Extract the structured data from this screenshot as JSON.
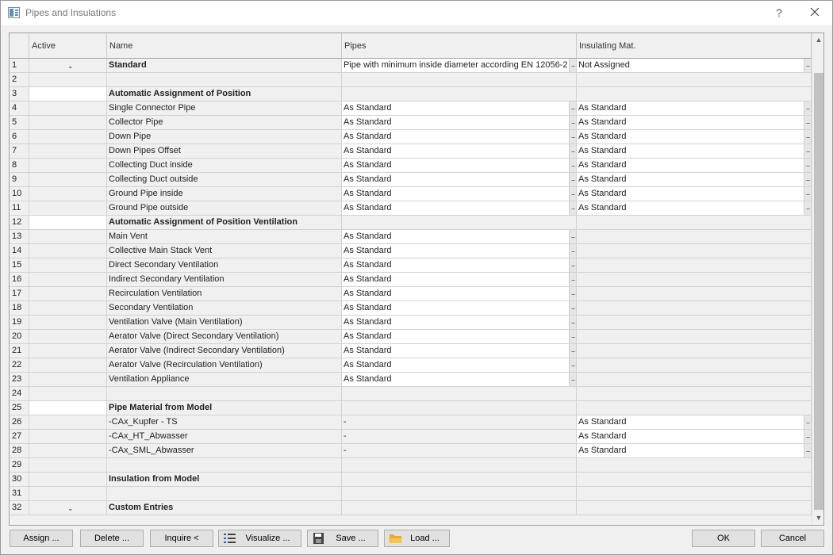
{
  "window": {
    "title": "Pipes and Insulations",
    "help_label": "?"
  },
  "columns": {
    "active": "Active",
    "name": "Name",
    "pipes": "Pipes",
    "insulating": "Insulating Mat."
  },
  "rows": [
    {
      "num": "1",
      "name": "Standard",
      "bold": true,
      "chevron": true,
      "pipes": "Pipe with minimum inside diameter according EN 12056-2",
      "pipes_btn": true,
      "insul": "Not Assigned",
      "insul_btn": true
    },
    {
      "num": "2",
      "name": "",
      "pipes": "",
      "insul": ""
    },
    {
      "num": "3",
      "name": "Automatic Assignment of Position",
      "bold": true,
      "active_white": true,
      "pipes": "",
      "insul": ""
    },
    {
      "num": "4",
      "name": "Single Connector Pipe",
      "pipes": "As Standard",
      "pipes_btn": true,
      "insul": "As Standard",
      "insul_btn": true
    },
    {
      "num": "5",
      "name": "Collector Pipe",
      "pipes": "As Standard",
      "pipes_btn": true,
      "insul": "As Standard",
      "insul_btn": true
    },
    {
      "num": "6",
      "name": "Down Pipe",
      "pipes": "As Standard",
      "pipes_btn": true,
      "insul": "As Standard",
      "insul_btn": true
    },
    {
      "num": "7",
      "name": "Down Pipes Offset",
      "pipes": "As Standard",
      "pipes_btn": true,
      "insul": "As Standard",
      "insul_btn": true
    },
    {
      "num": "8",
      "name": "Collecting Duct inside",
      "pipes": "As Standard",
      "pipes_btn": true,
      "insul": "As Standard",
      "insul_btn": true
    },
    {
      "num": "9",
      "name": "Collecting Duct outside",
      "pipes": "As Standard",
      "pipes_btn": true,
      "insul": "As Standard",
      "insul_btn": true
    },
    {
      "num": "10",
      "name": "Ground Pipe inside",
      "pipes": "As Standard",
      "pipes_btn": true,
      "insul": "As Standard",
      "insul_btn": true
    },
    {
      "num": "11",
      "name": "Ground Pipe outside",
      "pipes": "As Standard",
      "pipes_btn": true,
      "insul": "As Standard",
      "insul_btn": true
    },
    {
      "num": "12",
      "name": "Automatic Assignment of Position Ventilation",
      "bold": true,
      "active_white": true,
      "pipes": "",
      "insul": ""
    },
    {
      "num": "13",
      "name": "Main Vent",
      "pipes": "As Standard",
      "pipes_btn": true,
      "insul": ""
    },
    {
      "num": "14",
      "name": "Collective Main Stack Vent",
      "pipes": "As Standard",
      "pipes_btn": true,
      "insul": ""
    },
    {
      "num": "15",
      "name": "Direct Secondary Ventilation",
      "pipes": "As Standard",
      "pipes_btn": true,
      "insul": ""
    },
    {
      "num": "16",
      "name": "Indirect Secondary Ventilation",
      "pipes": "As Standard",
      "pipes_btn": true,
      "insul": ""
    },
    {
      "num": "17",
      "name": "Recirculation Ventilation",
      "pipes": "As Standard",
      "pipes_btn": true,
      "insul": ""
    },
    {
      "num": "18",
      "name": "Secondary Ventilation",
      "pipes": "As Standard",
      "pipes_btn": true,
      "insul": ""
    },
    {
      "num": "19",
      "name": "Ventilation Valve (Main Ventilation)",
      "pipes": "As Standard",
      "pipes_btn": true,
      "insul": ""
    },
    {
      "num": "20",
      "name": "Aerator Valve (Direct Secondary Ventilation)",
      "pipes": "As Standard",
      "pipes_btn": true,
      "insul": ""
    },
    {
      "num": "21",
      "name": "Aerator Valve (Indirect Secondary Ventilation)",
      "pipes": "As Standard",
      "pipes_btn": true,
      "insul": ""
    },
    {
      "num": "22",
      "name": "Aerator Valve (Recirculation Ventilation)",
      "pipes": "As Standard",
      "pipes_btn": true,
      "insul": ""
    },
    {
      "num": "23",
      "name": "Ventilation Appliance",
      "pipes": "As Standard",
      "pipes_btn": true,
      "insul": ""
    },
    {
      "num": "24",
      "name": "",
      "pipes": "",
      "insul": ""
    },
    {
      "num": "25",
      "name": "Pipe Material from Model",
      "bold": true,
      "active_white": true,
      "pipes": "",
      "insul": ""
    },
    {
      "num": "26",
      "name": "-CAx_Kupfer - TS",
      "pipes": "-",
      "insul": "As Standard",
      "insul_btn": true
    },
    {
      "num": "27",
      "name": "-CAx_HT_Abwasser",
      "pipes": "-",
      "insul": "As Standard",
      "insul_btn": true
    },
    {
      "num": "28",
      "name": "-CAx_SML_Abwasser",
      "pipes": "-",
      "insul": "As Standard",
      "insul_btn": true
    },
    {
      "num": "29",
      "name": "",
      "pipes": "",
      "insul": ""
    },
    {
      "num": "30",
      "name": "Insulation from Model",
      "bold": true,
      "pipes": "",
      "insul": ""
    },
    {
      "num": "31",
      "name": "",
      "pipes": "",
      "insul": ""
    },
    {
      "num": "32",
      "name": "Custom Entries",
      "bold": true,
      "chevron": true,
      "pipes": "",
      "insul": ""
    }
  ],
  "buttons": {
    "assign": "Assign ...",
    "delete": "Delete ...",
    "inquire": "Inquire <",
    "visualize": "Visualize ...",
    "save": "Save ...",
    "load": "Load ...",
    "ok": "OK",
    "cancel": "Cancel"
  },
  "icons": {
    "app": "app-window-icon",
    "close": "close-icon",
    "visualize": "list-icon",
    "save": "floppy-disk-icon",
    "load": "folder-icon",
    "expand": "chevron-down-icon",
    "ellipsis": "ellipsis-icon"
  }
}
